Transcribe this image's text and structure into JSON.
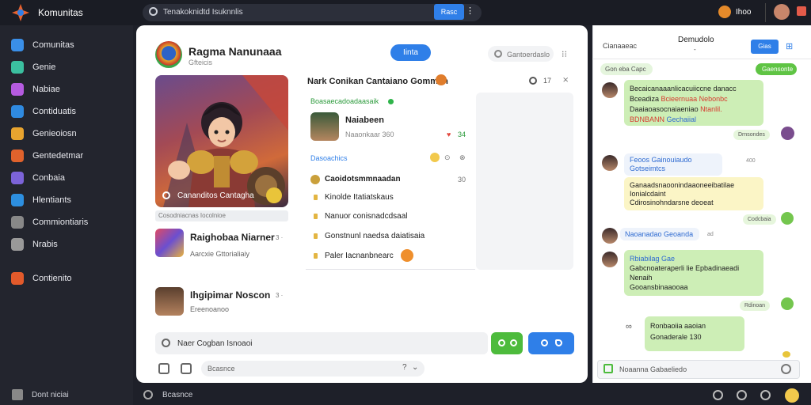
{
  "app": {
    "title": "Komunitas"
  },
  "search": {
    "text": "Tenakoknidtd Isuknnlis",
    "button": "Rasc",
    "more": "⋮"
  },
  "profile": {
    "name": "Ihoo"
  },
  "sidebar": {
    "items": [
      {
        "label": "Comunitas",
        "color": "#3a8fe8"
      },
      {
        "label": "Genie",
        "color": "#3bbf9f"
      },
      {
        "label": "Nabiae",
        "color": "#b55be0"
      },
      {
        "label": "Contiduatis",
        "color": "#2f8ae0"
      },
      {
        "label": "Genieoiosn",
        "color": "#e8a42f"
      },
      {
        "label": "Gentedetmar",
        "color": "#e0622c"
      },
      {
        "label": "Conbaia",
        "color": "#7c63d8"
      },
      {
        "label": "Hlentiants",
        "color": "#2d8fe0"
      },
      {
        "label": "Commiontiaris",
        "color": "#888888"
      },
      {
        "label": "Nrabis",
        "color": "#999999"
      },
      {
        "label": "Contienito",
        "color": "#e25a2b"
      }
    ],
    "bottom": "Dont niciai"
  },
  "main": {
    "game_title": "Ragma Nanunaaa",
    "game_sub": "Gfteicis",
    "join": "Iinta",
    "search_placeholder": "Gantoerdaslo",
    "menu": "⁝⁝",
    "hero_caption": "Cananditos Cantagha",
    "hero_under": "Cosodniacnas Iocolnioe",
    "cards": [
      {
        "title": "Raighobaa Niarner",
        "sub": "Aarcxie Gttorialiaiy",
        "meta": "3 ·"
      },
      {
        "title": "Ihgipimar Noscon",
        "sub": "Ereenoanoo",
        "meta": "3 ·"
      }
    ],
    "feed": {
      "title": "Nark Conikan Cantaiano Gomman",
      "count": "17",
      "close": "⨯",
      "live": "Boasaecadoadaasaik",
      "user_name": "Naiabeen",
      "user_status": "Naaonkaar 360",
      "user_heart": "♥",
      "user_count": "34",
      "section": "Dasoachics",
      "list_head": "Caoidotsmmnaadan",
      "list_count": "30",
      "items": [
        "Kinolde Itatiatskaus",
        "Nanuor conisnadcdsaal",
        "Gonstnunl naedsa daiatisaia",
        "Paler Iacnanbnearc"
      ]
    },
    "composer": "Naer Cogban Isnoaoi",
    "footer_input": "Bcasnce",
    "footer_icon": "?",
    "footer_chev": "⌄"
  },
  "chat": {
    "back": "Cianaaeac",
    "title": "Demudolo",
    "subtitle": "-",
    "button": "Gias",
    "grid": "⊞",
    "pill_left": "Gon eba Capc",
    "pill_right": "Gaensonte",
    "msg1": {
      "line1": "Becaicanaaanlicacuiiccne danacc",
      "line2a": "Bceadiza",
      "line2b": "Bcieernuaa Nebonbc",
      "line3a": "Daaiaoasocnaiaeniao",
      "line3b": "Ntanlil.",
      "line4a": "BDNBANN",
      "line4b": "Gechaiial"
    },
    "receipt1": "Drnsondes",
    "msg2_name": "Feoos Gainouiaudo",
    "msg2_text": "Gotseimtcs",
    "time2": "400",
    "msg3": {
      "line1": "Ganaadsnaoonindaaoneeibatilae",
      "line2": "Ionialcdaint",
      "line3": "Cdirosinohndarsne deoeat"
    },
    "receipt3": "Codcbaia",
    "msg4_name": "Naoanadao Geoanda",
    "time4": "ad",
    "msg5": {
      "line1": "Rbiabilag Gae",
      "line2": "Gabcnoateraperli lie Epbadinaeadi",
      "line3": "Nenaih",
      "line4": "Gooansbinaaooaa"
    },
    "receipt5": "Rdinoan",
    "msg6_icon": "∞",
    "msg6": {
      "line1": "Ronbaoiia aaoian",
      "line2": "Gonaderale 130"
    },
    "input": "Noaanna Gabaeliedo"
  }
}
